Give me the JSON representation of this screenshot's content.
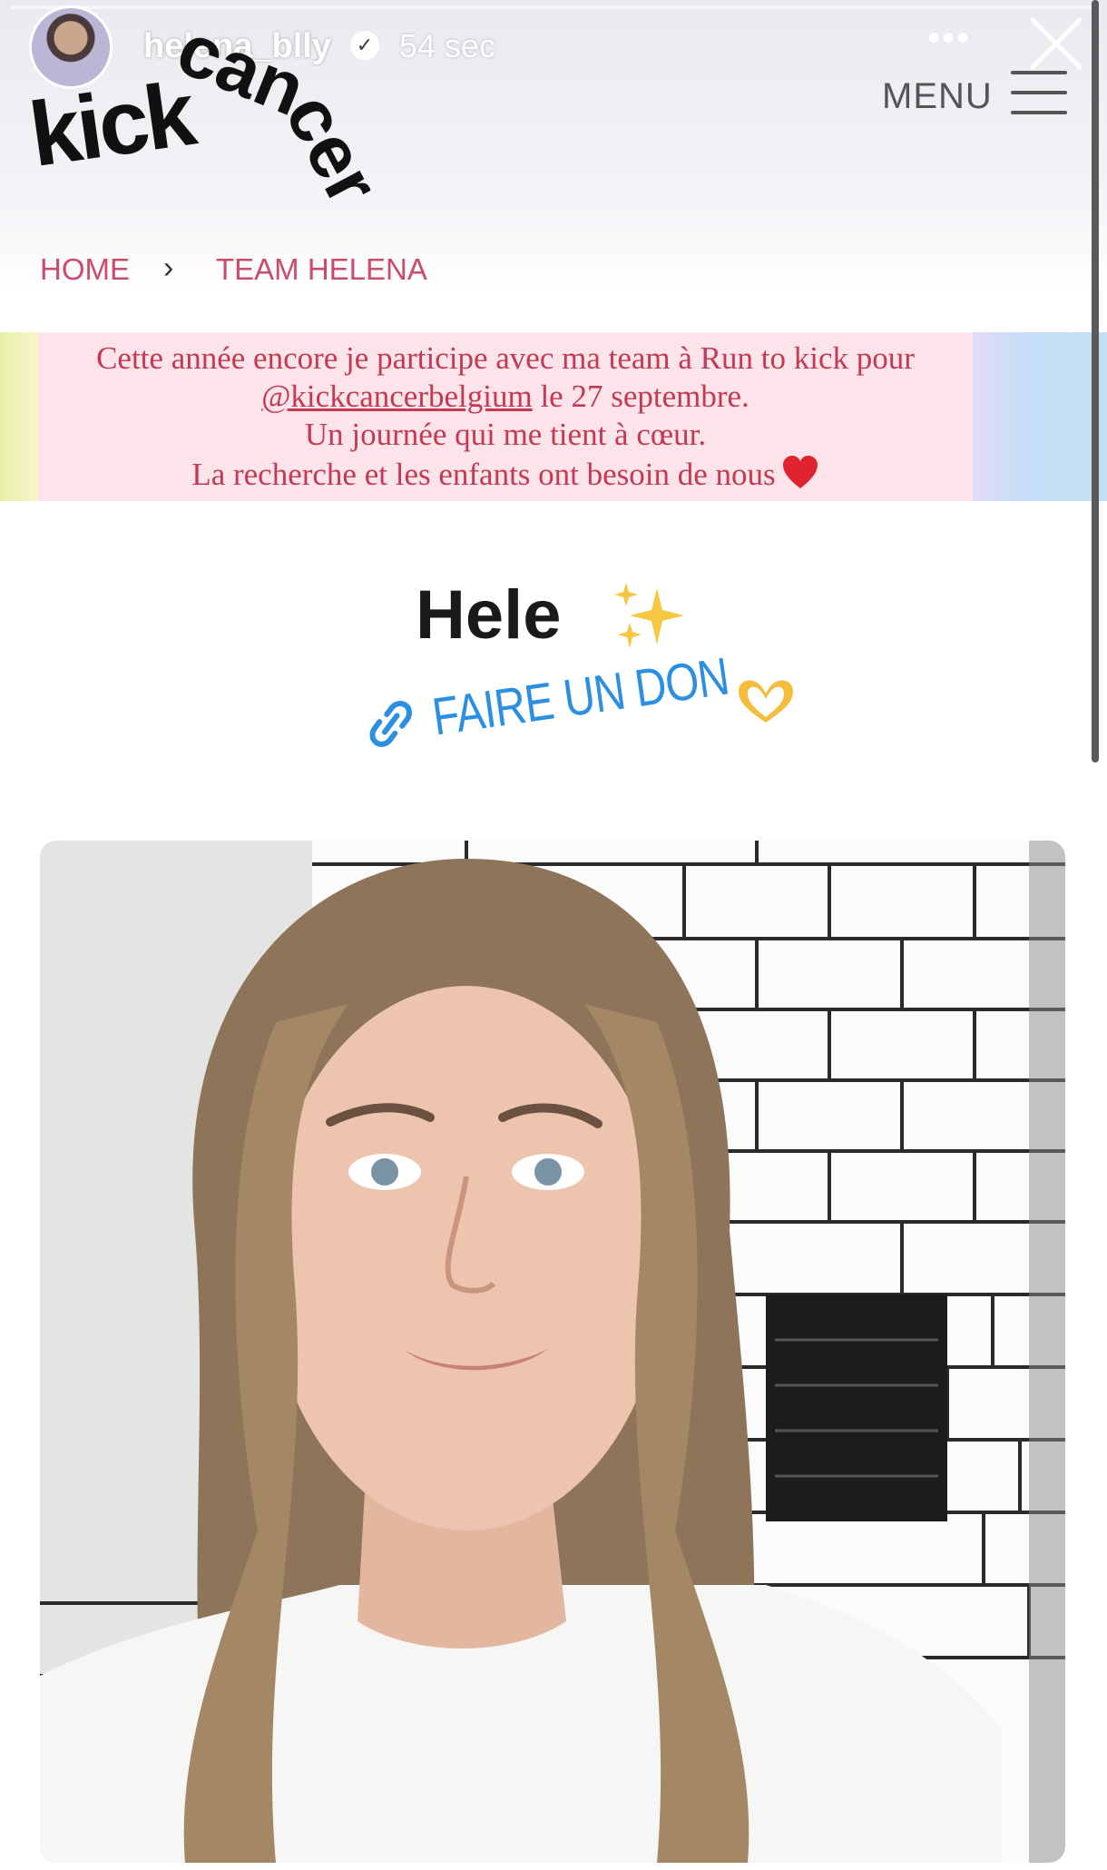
{
  "story": {
    "username": "helena_blly",
    "time_ago": "54 sec",
    "more_icon": "more-horizontal-icon",
    "close_icon": "close-icon"
  },
  "site": {
    "logo": {
      "kick": "kick",
      "can": "can",
      "cer": "cer"
    },
    "menu_label": "MENU",
    "breadcrumb": {
      "home": "HOME",
      "separator": "›",
      "current": "TEAM HELENA"
    }
  },
  "caption": {
    "line1": "Cette année encore je participe avec ma team à Run to kick pour",
    "mention": "@kickcancerbelgium",
    "line2_rest": " le 27 septembre.",
    "line3": "Un journée qui me tient à cœur.",
    "line4": "La recherche et les enfants ont besoin de nous"
  },
  "title": "Hele",
  "link_sticker": {
    "label": "FAIRE UN DON",
    "icon": "link-icon"
  },
  "colors": {
    "accent_pink": "#c94d6a",
    "caption_text": "#c23a53",
    "link_blue": "#2d8fe0"
  }
}
